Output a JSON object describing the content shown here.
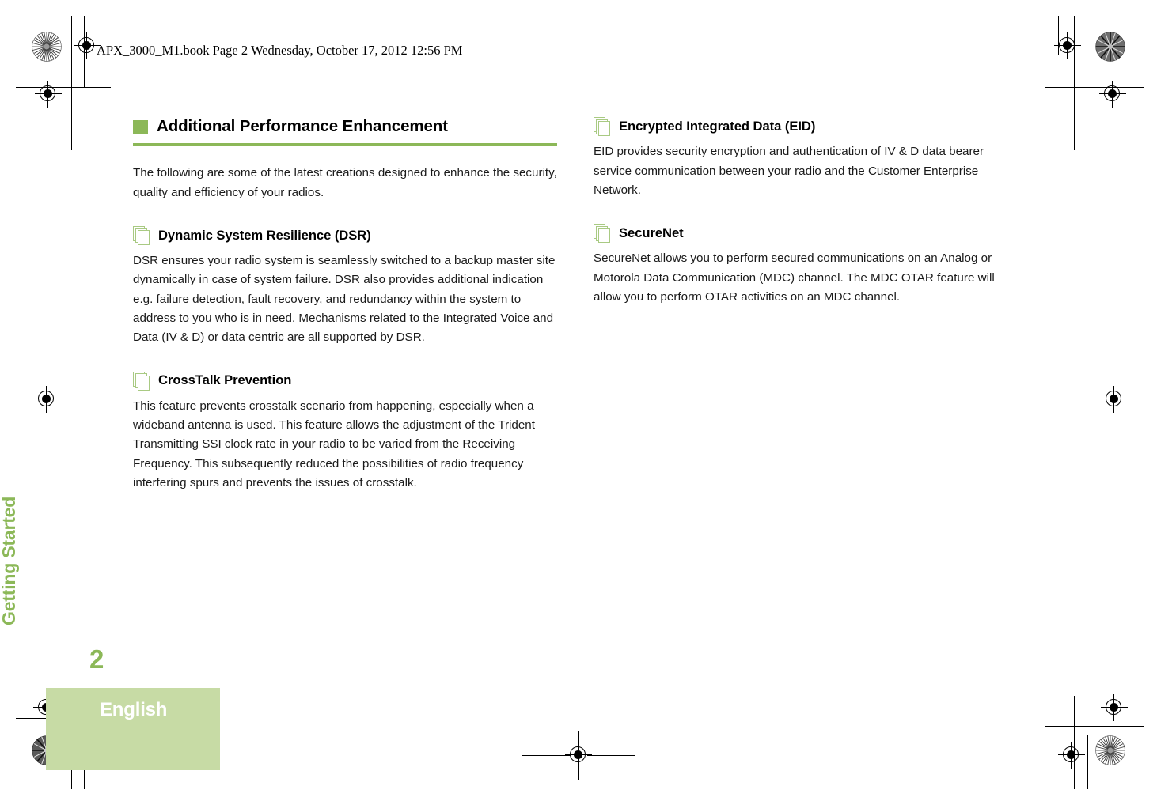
{
  "document": {
    "filestamp": "APX_3000_M1.book  Page 2  Wednesday, October 17, 2012  12:56 PM",
    "page_number": "2",
    "chapter_tab": "Getting Started",
    "language_label": "English",
    "colors": {
      "accent_green": "#8cb858",
      "pale_green": "#c7dba5",
      "icon_outline_green": "#a9ca83",
      "text": "#1a1a1a"
    }
  },
  "left_column": {
    "section": {
      "title": "Additional Performance Enhancement",
      "intro": "The following are some of the latest creations designed to enhance the security, quality and efficiency of your radios."
    },
    "subsections": [
      {
        "title": "Dynamic System Resilience (DSR)",
        "body": "DSR ensures your radio system is seamlessly switched to a backup master site dynamically in case of system failure. DSR also provides additional indication e.g. failure detection, fault recovery, and redundancy within the system to address to you who is in need. Mechanisms related to the Integrated Voice and Data (IV & D) or data centric are all supported by DSR."
      },
      {
        "title": "CrossTalk Prevention",
        "body": "This feature prevents crosstalk scenario from happening, especially when a wideband antenna is used. This feature allows the adjustment of the Trident Transmitting SSI clock rate in your radio to be varied from the Receiving Frequency. This subsequently reduced the possibilities of radio frequency interfering spurs and prevents the issues of crosstalk."
      }
    ]
  },
  "right_column": {
    "subsections": [
      {
        "title": "Encrypted Integrated Data (EID)",
        "body": "EID provides security encryption and authentication of IV & D data bearer service communication between your radio and the Customer Enterprise Network."
      },
      {
        "title": "SecureNet",
        "body": "SecureNet allows you to perform secured communications on an Analog or Motorola Data Communication (MDC) channel. The MDC OTAR feature will allow you to perform OTAR activities on an MDC channel."
      }
    ]
  }
}
